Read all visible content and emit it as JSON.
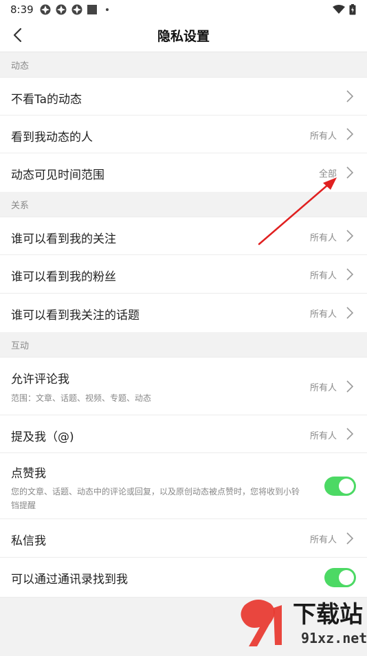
{
  "status": {
    "time": "8:39"
  },
  "header": {
    "title": "隐私设置"
  },
  "sections": {
    "dynamic": "动态",
    "relation": "关系",
    "interaction": "互动"
  },
  "rows": {
    "hide_ta": {
      "title": "不看Ta的动态"
    },
    "who_sees_me": {
      "title": "看到我动态的人",
      "value": "所有人"
    },
    "time_range": {
      "title": "动态可见时间范围",
      "value": "全部"
    },
    "see_following": {
      "title": "谁可以看到我的关注",
      "value": "所有人"
    },
    "see_fans": {
      "title": "谁可以看到我的粉丝",
      "value": "所有人"
    },
    "see_topics": {
      "title": "谁可以看到我关注的话题",
      "value": "所有人"
    },
    "allow_comment": {
      "title": "允许评论我",
      "subtitle": "范围：文章、话题、视频、专题、动态",
      "value": "所有人"
    },
    "mention": {
      "title": "提及我（@)",
      "value": "所有人"
    },
    "like": {
      "title": "点赞我",
      "subtitle": "您的文章、话题、动态中的评论或回复，以及原创动态被点赞时，您将收到小铃铛提醒",
      "toggle_on": true
    },
    "message": {
      "title": "私信我",
      "value": "所有人"
    },
    "contacts": {
      "title": "可以通过通讯录找到我",
      "toggle_on": true
    }
  },
  "watermark": {
    "brand": "下载站",
    "site": "91xz.net"
  },
  "colors": {
    "toggle": "#4cd964",
    "arrow": "#e02020",
    "background": "#f2f2f2"
  }
}
